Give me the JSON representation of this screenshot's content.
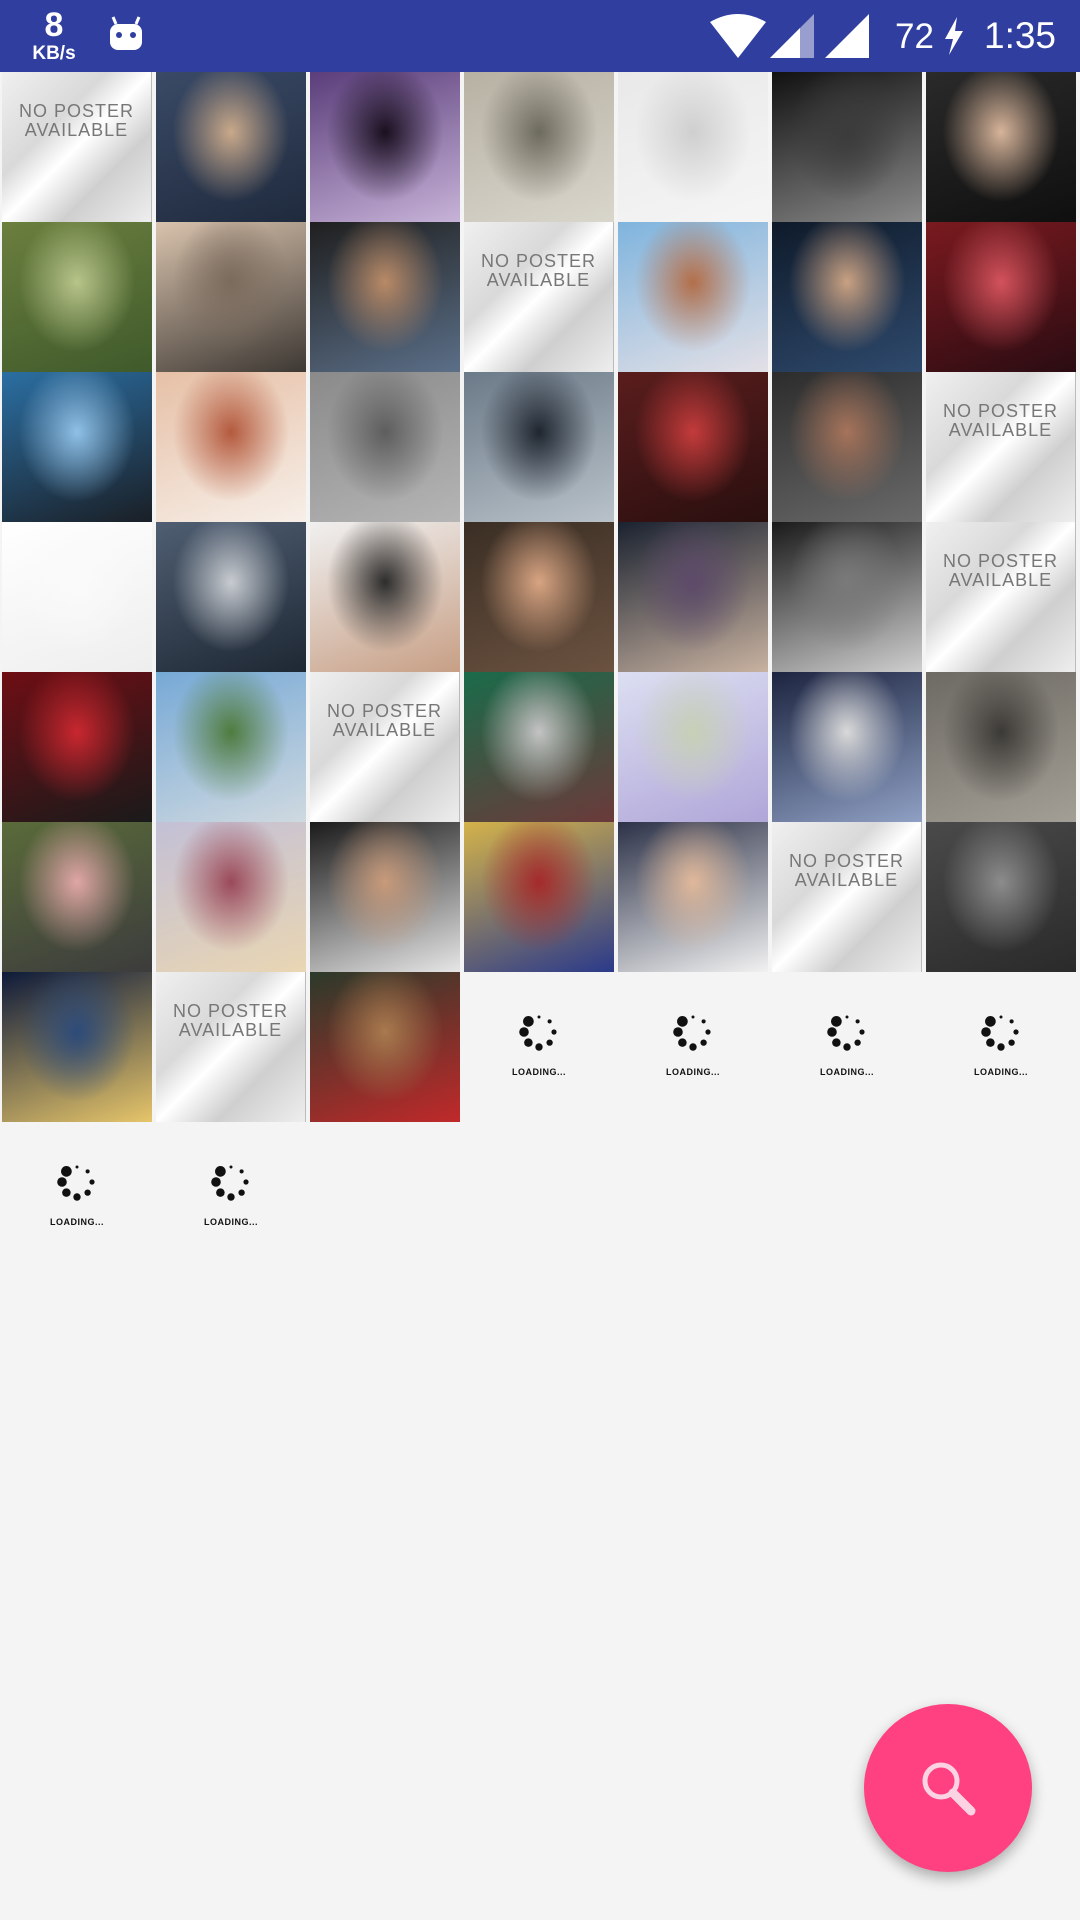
{
  "status_bar": {
    "net_speed": "8",
    "net_unit": "KB/s",
    "battery": "72",
    "time": "1:35",
    "icons": [
      "android-notification-icon",
      "wifi-icon",
      "cell-signal-icon",
      "cell-signal-icon",
      "charging-bolt-icon"
    ]
  },
  "grid": {
    "no_poster_text": "NO POSTER\nAVAILABLE",
    "loading_text": "LOADING...",
    "tiles": [
      {
        "kind": "no-poster"
      },
      {
        "kind": "photo",
        "colors": [
          "#3a4a66",
          "#c9a98a",
          "#1f2a3d"
        ]
      },
      {
        "kind": "photo",
        "colors": [
          "#5a3d7a",
          "#1a1020",
          "#c7b3d8"
        ]
      },
      {
        "kind": "photo",
        "colors": [
          "#b7b1a3",
          "#6d6a5e",
          "#d9d6cc"
        ]
      },
      {
        "kind": "photo",
        "colors": [
          "#e9e9e9",
          "#cfcfcf",
          "#f5f5f5"
        ]
      },
      {
        "kind": "photo",
        "colors": [
          "#111111",
          "#3b3b3b",
          "#8a8a8a"
        ]
      },
      {
        "kind": "photo",
        "colors": [
          "#2a2a2a",
          "#d7b49a",
          "#0f0f0f"
        ]
      },
      {
        "kind": "photo",
        "colors": [
          "#6b7f3e",
          "#b7c48a",
          "#3f5a2b"
        ]
      },
      {
        "kind": "photo",
        "colors": [
          "#d9c3ad",
          "#7b6b5d",
          "#3d3833"
        ]
      },
      {
        "kind": "photo",
        "colors": [
          "#1f1f1f",
          "#b98a66",
          "#5b6f88"
        ]
      },
      {
        "kind": "no-poster"
      },
      {
        "kind": "photo",
        "colors": [
          "#7fb4de",
          "#b36f4a",
          "#e3e0e6"
        ]
      },
      {
        "kind": "photo",
        "colors": [
          "#0e1a2a",
          "#c9a182",
          "#2f4a6d"
        ]
      },
      {
        "kind": "photo",
        "colors": [
          "#7a1a1f",
          "#d3525c",
          "#2a0c12"
        ]
      },
      {
        "kind": "photo",
        "colors": [
          "#2b6fa3",
          "#8fc0e6",
          "#1a1f26"
        ]
      },
      {
        "kind": "photo",
        "colors": [
          "#e6c0a6",
          "#b45a3e",
          "#f7efe8"
        ]
      },
      {
        "kind": "photo",
        "colors": [
          "#8a8a8a",
          "#5e5e5e",
          "#b5b5b5"
        ]
      },
      {
        "kind": "photo",
        "colors": [
          "#6b7a88",
          "#1f2630",
          "#b9c2c9"
        ]
      },
      {
        "kind": "photo",
        "colors": [
          "#5a1d1d",
          "#c43b3b",
          "#2a0f0f"
        ]
      },
      {
        "kind": "photo",
        "colors": [
          "#2c2c2c",
          "#a6735a",
          "#6a6a6a"
        ]
      },
      {
        "kind": "no-poster"
      },
      {
        "kind": "photo",
        "colors": [
          "#ffffff",
          "#fafafa",
          "#eeeeee"
        ]
      },
      {
        "kind": "photo",
        "colors": [
          "#4f5e72",
          "#c8ccd1",
          "#1e2834"
        ]
      },
      {
        "kind": "photo",
        "colors": [
          "#f0f0f0",
          "#2d2d2d",
          "#c79f85"
        ]
      },
      {
        "kind": "photo",
        "colors": [
          "#3a2e24",
          "#d8a482",
          "#6b5240"
        ]
      },
      {
        "kind": "photo",
        "colors": [
          "#1a2230",
          "#5d4a6a",
          "#c8b2a0"
        ]
      },
      {
        "kind": "photo",
        "colors": [
          "#1a1a1a",
          "#7a7a7a",
          "#cfcfcf"
        ]
      },
      {
        "kind": "no-poster"
      },
      {
        "kind": "photo",
        "colors": [
          "#6e0e14",
          "#c9272f",
          "#1a1a1a"
        ]
      },
      {
        "kind": "photo",
        "colors": [
          "#76a9d6",
          "#4f7c3f",
          "#cfd9e0"
        ]
      },
      {
        "kind": "no-poster"
      },
      {
        "kind": "photo",
        "colors": [
          "#1a6b4a",
          "#c3c3c3",
          "#6b3a3a"
        ]
      },
      {
        "kind": "photo",
        "colors": [
          "#dcdff2",
          "#c7d0b6",
          "#b0a6d8"
        ]
      },
      {
        "kind": "photo",
        "colors": [
          "#1c2440",
          "#d9d9d9",
          "#8fa0c4"
        ]
      },
      {
        "kind": "photo",
        "colors": [
          "#6d6a63",
          "#3c3a36",
          "#a39f96"
        ]
      },
      {
        "kind": "photo",
        "colors": [
          "#5a6b3a",
          "#e0a6a6",
          "#3c3c3c"
        ]
      },
      {
        "kind": "photo",
        "colors": [
          "#c3c0d6",
          "#9b4a5a",
          "#e9d6b3"
        ]
      },
      {
        "kind": "photo",
        "colors": [
          "#1a1a1a",
          "#c89a7a",
          "#e6e6e6"
        ]
      },
      {
        "kind": "photo",
        "colors": [
          "#d4b34a",
          "#a52a2a",
          "#2b3a8a"
        ]
      },
      {
        "kind": "photo",
        "colors": [
          "#2c3248",
          "#e0b89a",
          "#f1f1f1"
        ]
      },
      {
        "kind": "no-poster"
      },
      {
        "kind": "photo",
        "colors": [
          "#4a4a4a",
          "#8c8c8c",
          "#2a2a2a"
        ]
      },
      {
        "kind": "photo",
        "colors": [
          "#0d1a3a",
          "#2d4b7a",
          "#e6c56a"
        ]
      },
      {
        "kind": "no-poster"
      },
      {
        "kind": "photo",
        "colors": [
          "#2b3a2a",
          "#a87a4e",
          "#c0292a"
        ]
      },
      {
        "kind": "loading"
      },
      {
        "kind": "loading"
      },
      {
        "kind": "loading"
      },
      {
        "kind": "loading"
      },
      {
        "kind": "loading"
      },
      {
        "kind": "loading"
      }
    ]
  },
  "fab": {
    "icon": "search-icon",
    "color": "#ff4081"
  }
}
